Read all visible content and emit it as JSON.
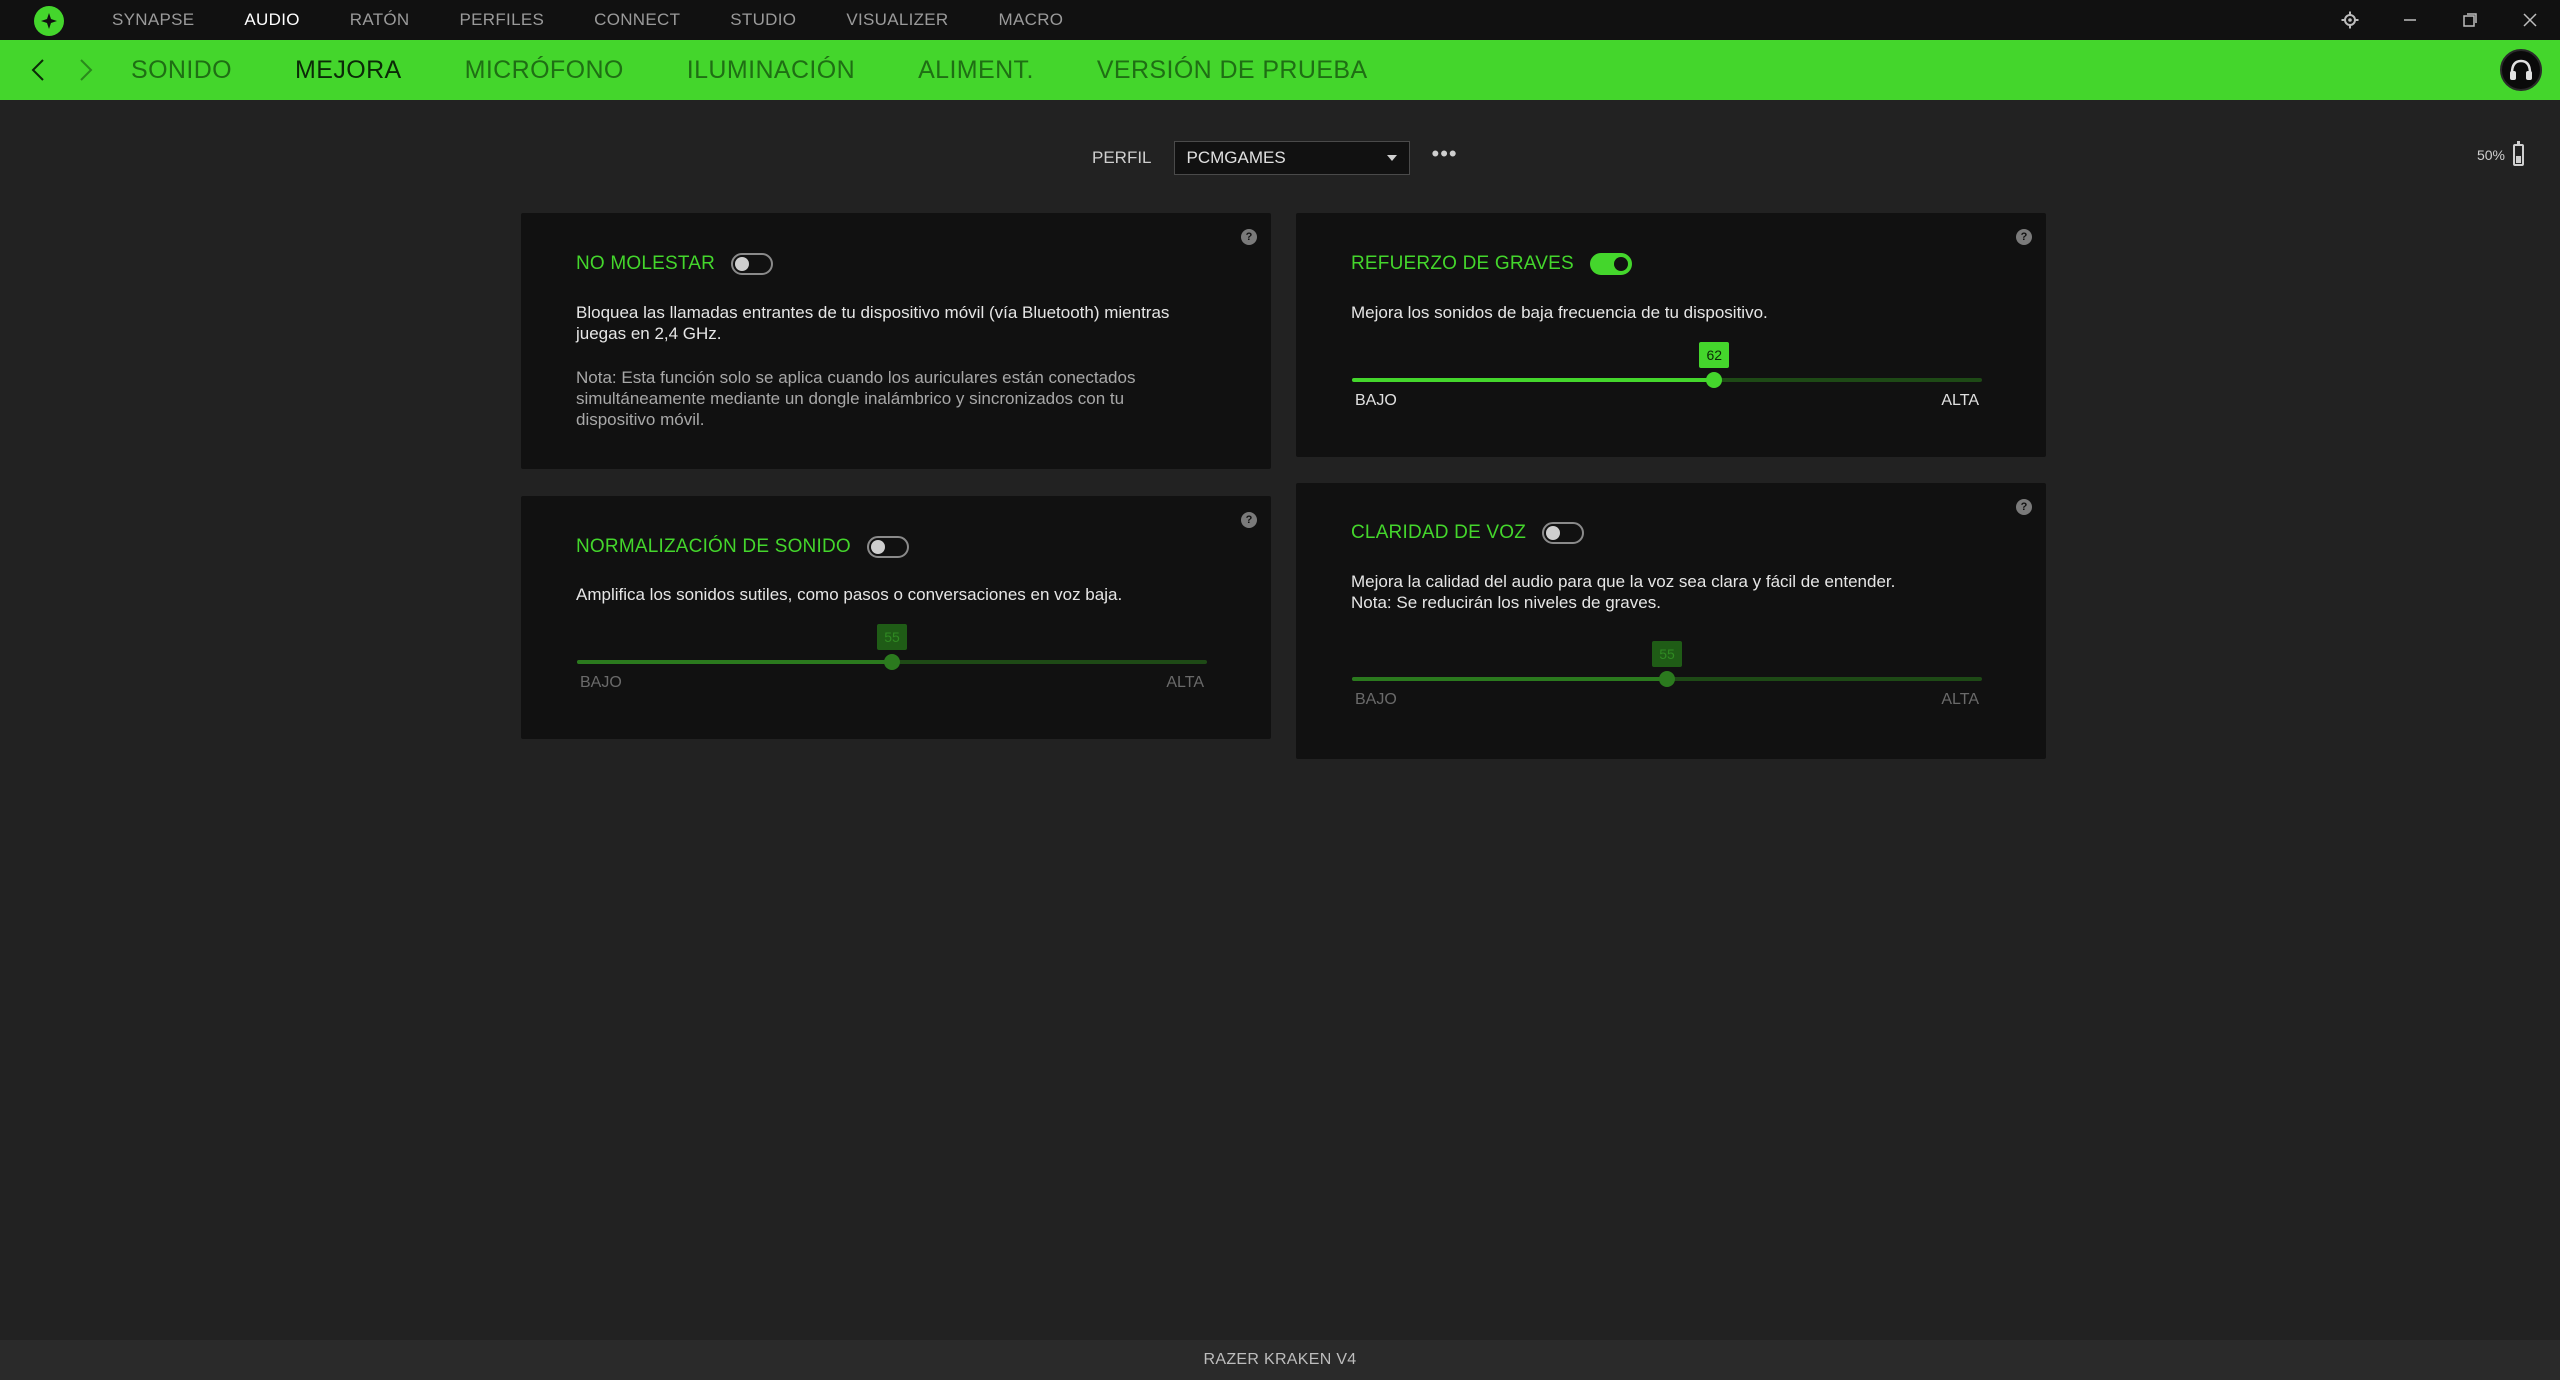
{
  "top_nav": {
    "items": [
      {
        "label": "SYNAPSE",
        "active": false
      },
      {
        "label": "AUDIO",
        "active": true
      },
      {
        "label": "RATÓN",
        "active": false
      },
      {
        "label": "PERFILES",
        "active": false
      },
      {
        "label": "CONNECT",
        "active": false
      },
      {
        "label": "STUDIO",
        "active": false
      },
      {
        "label": "VISUALIZER",
        "active": false
      },
      {
        "label": "MACRO",
        "active": false
      }
    ]
  },
  "sub_nav": {
    "tabs": [
      {
        "label": "SONIDO",
        "active": false
      },
      {
        "label": "MEJORA",
        "active": true
      },
      {
        "label": "MICRÓFONO",
        "active": false
      },
      {
        "label": "ILUMINACIÓN",
        "active": false
      },
      {
        "label": "ALIMENT.",
        "active": false
      },
      {
        "label": "VERSIÓN DE PRUEBA",
        "active": false
      }
    ]
  },
  "profile": {
    "label": "PERFIL",
    "selected": "PCMGAMES",
    "more": "•••"
  },
  "battery": {
    "text": "50%",
    "level": 0.5
  },
  "panels": {
    "no_molestar": {
      "title": "NO MOLESTAR",
      "enabled": false,
      "desc_1": "Bloquea las llamadas entrantes de tu dispositivo móvil (vía Bluetooth) mientras",
      "desc_2": "juegas en 2,4 GHz.",
      "note_1": "Nota: Esta función solo se aplica cuando los auriculares están conectados",
      "note_2": "simultáneamente mediante un dongle inalámbrico y sincronizados con tu",
      "note_3": "dispositivo móvil.",
      "help": "?"
    },
    "normalizacion": {
      "title": "NORMALIZACIÓN DE SONIDO",
      "enabled": false,
      "desc_1": "Amplifica los sonidos sutiles, como pasos o conversaciones en voz baja.",
      "slider": {
        "value": "55",
        "min_label": "BAJO",
        "max_label": "ALTA",
        "fraction": 0.5
      },
      "help": "?"
    },
    "refuerzo": {
      "title": "REFUERZO DE GRAVES",
      "enabled": true,
      "desc_1": "Mejora los sonidos de baja frecuencia de tu dispositivo.",
      "slider": {
        "value": "62",
        "min_label": "BAJO",
        "max_label": "ALTA",
        "fraction": 0.575
      },
      "help": "?"
    },
    "claridad": {
      "title": "CLARIDAD DE VOZ",
      "enabled": false,
      "desc_1": "Mejora la calidad del audio para que la voz sea clara y fácil de entender.",
      "desc_2": "Nota: Se reducirán los niveles de graves.",
      "slider": {
        "value": "55",
        "min_label": "BAJO",
        "max_label": "ALTA",
        "fraction": 0.5
      },
      "help": "?"
    }
  },
  "footer": {
    "device_name": "RAZER KRAKEN V4"
  },
  "colors": {
    "accent": "#44d62c",
    "panel_bg": "#111111",
    "page_bg": "#222222"
  },
  "icons": {
    "logo": "razer-logo-icon",
    "settings": "gear-icon",
    "minimize": "minimize-icon",
    "maximize": "restore-icon",
    "close": "close-icon",
    "back": "chevron-left-icon",
    "forward": "chevron-right-icon",
    "device": "headset-avatar-icon",
    "dropdown": "caret-down-icon",
    "help": "help-icon",
    "battery": "battery-icon"
  }
}
